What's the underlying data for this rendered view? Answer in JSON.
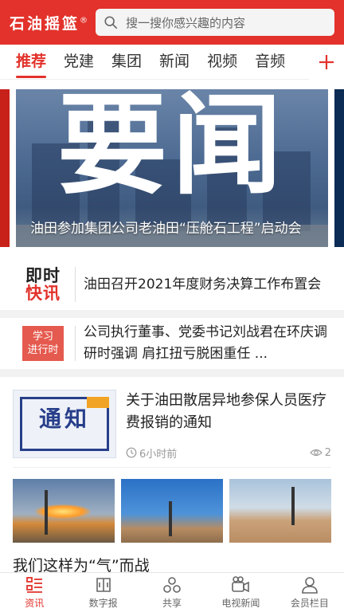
{
  "header": {
    "logo": "石油摇篮",
    "logo_mark": "®",
    "search_placeholder": "搜一搜你感兴趣的内容"
  },
  "tabs": [
    {
      "label": "推荐",
      "active": true
    },
    {
      "label": "党建"
    },
    {
      "label": "集团"
    },
    {
      "label": "新闻"
    },
    {
      "label": "视频"
    },
    {
      "label": "音频"
    }
  ],
  "banner": {
    "big_text": "要闻",
    "caption": "油田参加集团公司老油田“压舱石工程”启动会"
  },
  "flash": [
    {
      "logo_line1": "即时",
      "logo_line2": "快讯",
      "text": "油田召开2021年度财务决算工作布置会"
    },
    {
      "logo_line1": "学习",
      "logo_line2": "进行时",
      "text": "公司执行董事、党委书记刘战君在环庆调研时强调 肩扛扭亏脱困重任 ..."
    }
  ],
  "news": {
    "item1": {
      "thumb_text": "通知",
      "title": "关于油田散居异地参保人员医疗费报销的通知",
      "time": "6小时前",
      "views": "2"
    },
    "item2_title": "我们这样为“气”而战"
  },
  "bottom_nav": [
    {
      "label": "资讯",
      "icon": "news-icon",
      "active": true
    },
    {
      "label": "数字报",
      "icon": "newspaper-icon"
    },
    {
      "label": "共享",
      "icon": "share-icon"
    },
    {
      "label": "电视新闻",
      "icon": "video-camera-icon"
    },
    {
      "label": "会员栏目",
      "icon": "user-icon"
    }
  ],
  "colors": {
    "brand_red": "#e2322b",
    "banner_blue": "#4d6a92",
    "notice_blue": "#273e8a"
  }
}
